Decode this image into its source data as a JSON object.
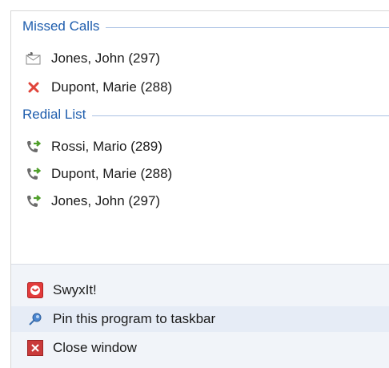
{
  "sections": {
    "missed": {
      "title": "Missed Calls",
      "items": [
        {
          "label": "Jones, John (297)",
          "icon": "missed-call-envelope-icon"
        },
        {
          "label": "Dupont, Marie (288)",
          "icon": "red-x-icon"
        }
      ]
    },
    "redial": {
      "title": "Redial List",
      "items": [
        {
          "label": "Rossi, Mario (289)",
          "icon": "phone-redial-icon"
        },
        {
          "label": "Dupont, Marie (288)",
          "icon": "phone-redial-icon"
        },
        {
          "label": "Jones, John (297)",
          "icon": "phone-redial-icon"
        }
      ]
    }
  },
  "footer": {
    "app_label": "SwyxIt!",
    "pin_label": "Pin this program to taskbar",
    "close_label": "Close window"
  },
  "colors": {
    "section_title": "#1e5dad",
    "footer_bg": "#f1f4f9",
    "highlight_bg": "#e6ecf6",
    "red_x": "#e0443a",
    "phone_green": "#4f9f2a"
  }
}
